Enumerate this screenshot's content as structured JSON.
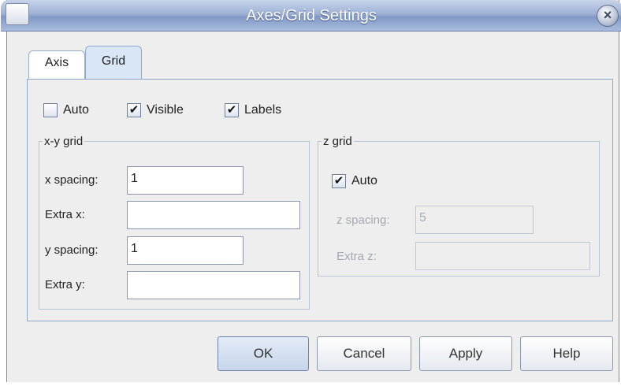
{
  "window": {
    "title": "Axes/Grid Settings",
    "close_glyph": "×"
  },
  "tabs": [
    {
      "label": "Axis"
    },
    {
      "label": "Grid"
    }
  ],
  "options": {
    "auto": {
      "label": "Auto",
      "checked": false
    },
    "visible": {
      "label": "Visible",
      "checked": true
    },
    "labels": {
      "label": "Labels",
      "checked": true
    }
  },
  "check_glyph": "✔",
  "xy_grid": {
    "title": "x-y grid",
    "x_spacing_label": "x spacing:",
    "x_spacing_value": "1",
    "extra_x_label": "Extra x:",
    "extra_x_value": "",
    "y_spacing_label": "y spacing:",
    "y_spacing_value": "1",
    "extra_y_label": "Extra y:",
    "extra_y_value": ""
  },
  "z_grid": {
    "title": "z grid",
    "auto_label": "Auto",
    "auto_checked": true,
    "z_spacing_label": "z spacing:",
    "z_spacing_value": "5",
    "extra_z_label": "Extra z:",
    "extra_z_value": ""
  },
  "buttons": {
    "ok": "OK",
    "cancel": "Cancel",
    "apply": "Apply",
    "help": "Help"
  }
}
